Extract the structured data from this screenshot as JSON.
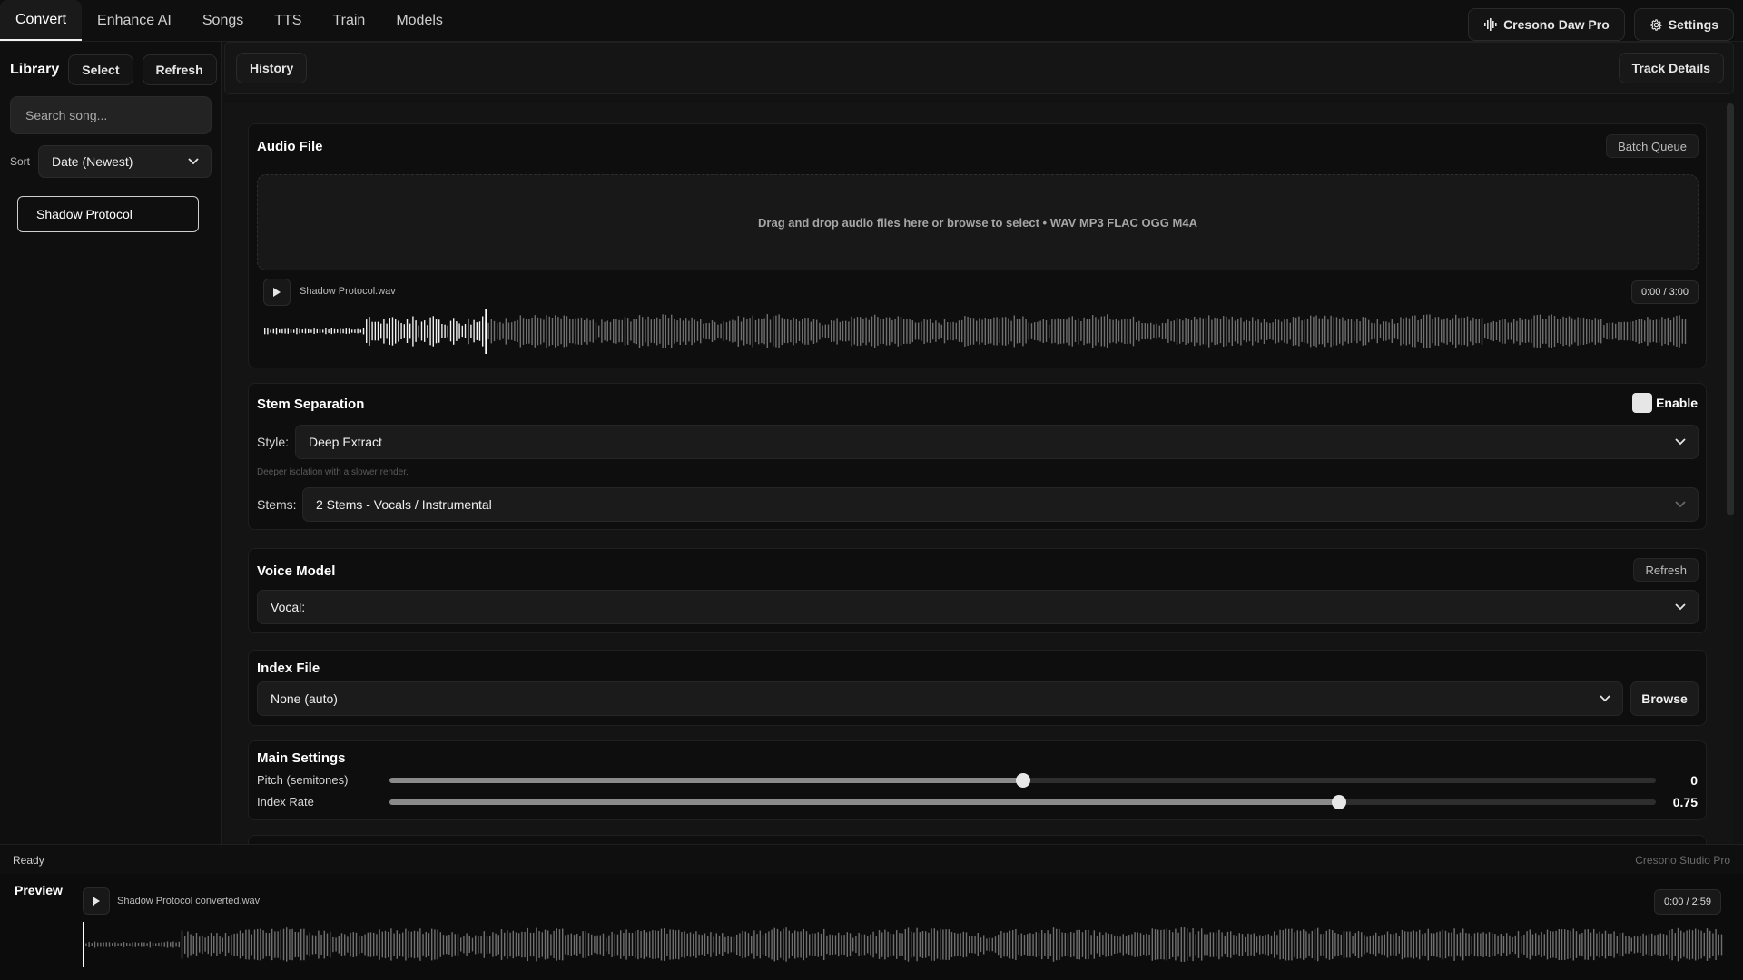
{
  "nav": {
    "tabs": [
      {
        "label": "Convert"
      },
      {
        "label": "Enhance AI"
      },
      {
        "label": "Songs"
      },
      {
        "label": "TTS"
      },
      {
        "label": "Train"
      },
      {
        "label": "Models"
      }
    ],
    "daw_label": "Cresono Daw Pro",
    "settings_label": "Settings"
  },
  "sidebar": {
    "title": "Library",
    "select_label": "Select",
    "refresh_label": "Refresh",
    "search_placeholder": "Search song...",
    "sort_label": "Sort",
    "sort_value": "Date (Newest)",
    "songs": [
      {
        "label": "Shadow Protocol"
      }
    ]
  },
  "subbar": {
    "history_label": "History",
    "track_details_label": "Track Details"
  },
  "audio_file": {
    "title": "Audio File",
    "batch_queue_label": "Batch Queue",
    "dropzone_text": "Drag and drop audio files here or browse to select • WAV MP3 FLAC OGG M4A",
    "file_name": "Shadow Protocol.wav",
    "time": "0:00 / 3:00",
    "playhead_fraction": 0.155
  },
  "stem_separation": {
    "title": "Stem Separation",
    "enable_label": "Enable",
    "style_label": "Style:",
    "style_value": "Deep Extract",
    "style_hint": "Deeper isolation with a slower render.",
    "stems_label": "Stems:",
    "stems_value": "2 Stems - Vocals / Instrumental"
  },
  "voice_model": {
    "title": "Voice Model",
    "refresh_label": "Refresh",
    "value": "Vocal:"
  },
  "index_file": {
    "title": "Index File",
    "value": "None (auto)",
    "browse_label": "Browse"
  },
  "main_settings": {
    "title": "Main Settings",
    "pitch": {
      "label": "Pitch (semitones)",
      "value": "0",
      "fraction": 0.5
    },
    "index_rate": {
      "label": "Index Rate",
      "value": "0.75",
      "fraction": 0.75
    }
  },
  "status": {
    "left": "Ready",
    "right": "Cresono Studio Pro"
  },
  "preview": {
    "title": "Preview",
    "file_name": "Shadow Protocol converted.wav",
    "time": "0:00 / 2:59"
  },
  "colors": {
    "background": "#0e0e0e",
    "panel": "#141414",
    "accent": "#e6e6e6",
    "muted": "#6a6a6a"
  }
}
